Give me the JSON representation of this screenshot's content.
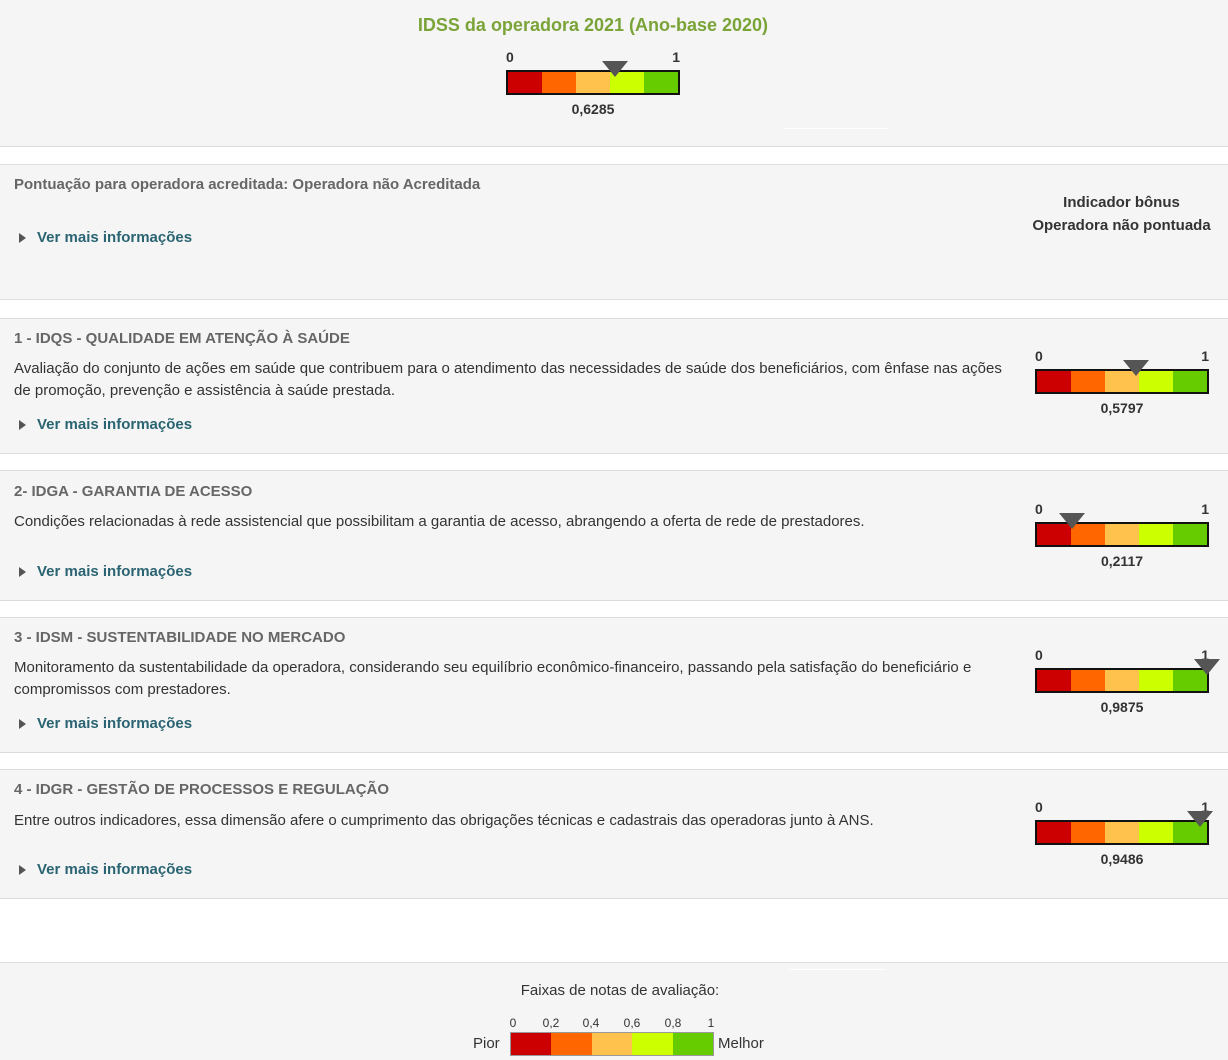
{
  "header": {
    "title": "IDSS da operadora 2021 (Ano-base 2020)",
    "gauge": {
      "min_label": "0",
      "max_label": "1",
      "value": 0.6285,
      "value_label": "0,6285"
    }
  },
  "accreditation": {
    "title": "Pontuação para operadora acreditada: Operadora não Acreditada",
    "more_label": "Ver mais informações",
    "bonus_title": "Indicador bônus",
    "bonus_status": "Operadora não pontuada"
  },
  "sections": [
    {
      "title": "1 - IDQS - QUALIDADE EM ATENÇÃO À SAÚDE",
      "description": "Avaliação do conjunto de ações em saúde que contribuem para o atendimento das necessidades de saúde dos beneficiários, com ênfase nas ações de promoção, prevenção e assistência à saúde prestada.",
      "more_label": "Ver mais informações",
      "gauge": {
        "min_label": "0",
        "max_label": "1",
        "value": 0.5797,
        "value_label": "0,5797"
      }
    },
    {
      "title": "2- IDGA - GARANTIA DE ACESSO",
      "description": "Condições relacionadas à rede assistencial que possibilitam a garantia de acesso, abrangendo a oferta de rede de prestadores.",
      "more_label": "Ver mais informações",
      "gauge": {
        "min_label": "0",
        "max_label": "1",
        "value": 0.2117,
        "value_label": "0,2117"
      }
    },
    {
      "title": "3 - IDSM - SUSTENTABILIDADE NO MERCADO",
      "description": "Monitoramento da sustentabilidade da operadora, considerando seu equilíbrio econômico-financeiro, passando pela satisfação do beneficiário e compromissos com prestadores.",
      "more_label": "Ver mais informações",
      "gauge": {
        "min_label": "0",
        "max_label": "1",
        "value": 0.9875,
        "value_label": "0,9875"
      }
    },
    {
      "title": "4 - IDGR - GESTÃO DE PROCESSOS E REGULAÇÃO",
      "description": "Entre outros indicadores, essa dimensão afere o cumprimento das obrigações técnicas e cadastrais das operadoras junto à ANS.",
      "more_label": "Ver mais informações",
      "gauge": {
        "min_label": "0",
        "max_label": "1",
        "value": 0.9486,
        "value_label": "0,9486"
      }
    }
  ],
  "legend": {
    "title": "Faixas de notas de avaliação:",
    "ticks": [
      "0",
      "0,2",
      "0,4",
      "0,6",
      "0,8",
      "1"
    ],
    "worst_label": "Pior",
    "best_label": "Melhor"
  },
  "colors": {
    "title_green": "#7aa338",
    "link_teal": "#2a6472",
    "band_1": "#cc0000",
    "band_2": "#ff6600",
    "band_3": "#ffc34d",
    "band_4": "#ccff00",
    "band_5": "#66cc00"
  },
  "icons": {
    "expand": "triangle-right-icon",
    "marker": "triangle-down-marker-icon"
  }
}
